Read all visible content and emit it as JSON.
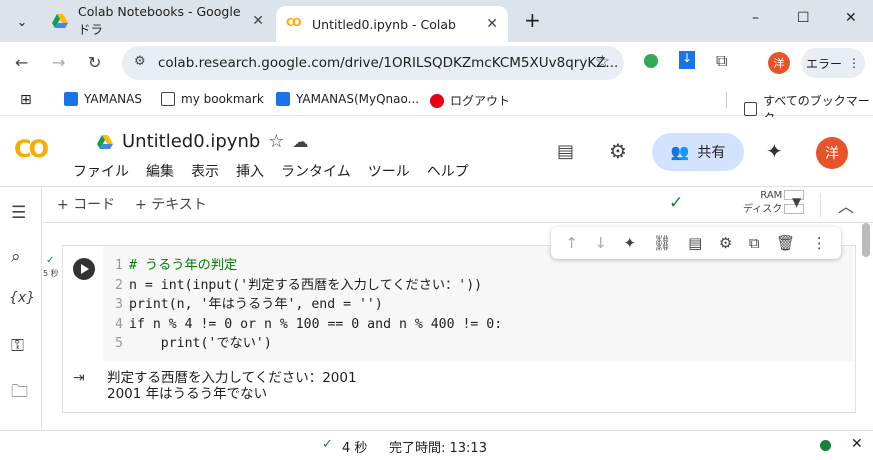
{
  "tabs": [
    {
      "label": "Colab Notebooks - Google ドラ",
      "close": "✕"
    },
    {
      "label": "Untitled0.ipynb - Colab",
      "close": "✕"
    }
  ],
  "window": {
    "minimize": "–",
    "maximize": "☐",
    "close": "✕",
    "new_tab": "+",
    "tablist": "⌄"
  },
  "address": {
    "url": "colab.research.google.com/drive/1ORILSQDKZmcKCM5XUv8qryKZ...",
    "profile": "洋",
    "error_label": "エラー"
  },
  "bookmarks": [
    {
      "label": "YAMANAS"
    },
    {
      "label": "my bookmark"
    },
    {
      "label": "YAMANAS(MyQnao..."
    },
    {
      "label": "ログアウト"
    }
  ],
  "all_bookmarks": "すべてのブックマーク",
  "notebook": {
    "title": "Untitled0.ipynb",
    "menu": [
      "ファイル",
      "編集",
      "表示",
      "挿入",
      "ランタイム",
      "ツール",
      "ヘルプ"
    ],
    "share": "共有",
    "avatar": "洋"
  },
  "toolbar": {
    "add_code": "+ コード",
    "add_text": "+ テキスト",
    "ram": "RAM",
    "disk": "ディスク"
  },
  "cell": {
    "exec_time": "5 秒",
    "lines": [
      {
        "n": "1",
        "text": "# うるう年の判定"
      },
      {
        "n": "2",
        "text": "n = int(input('判定する西暦を入力してください：'))"
      },
      {
        "n": "3",
        "text": "print(n, '年はうるう年', end = '')"
      },
      {
        "n": "4",
        "text": "if n % 4 != 0 or n % 100 == 0 and n % 400 != 0:"
      },
      {
        "n": "5",
        "text": "    print('でない')"
      }
    ],
    "output": [
      "判定する西暦を入力してください：2001",
      "2001 年はうるう年でない"
    ]
  },
  "status": {
    "time": "4 秒",
    "completed": "完了時間: 13:13"
  }
}
